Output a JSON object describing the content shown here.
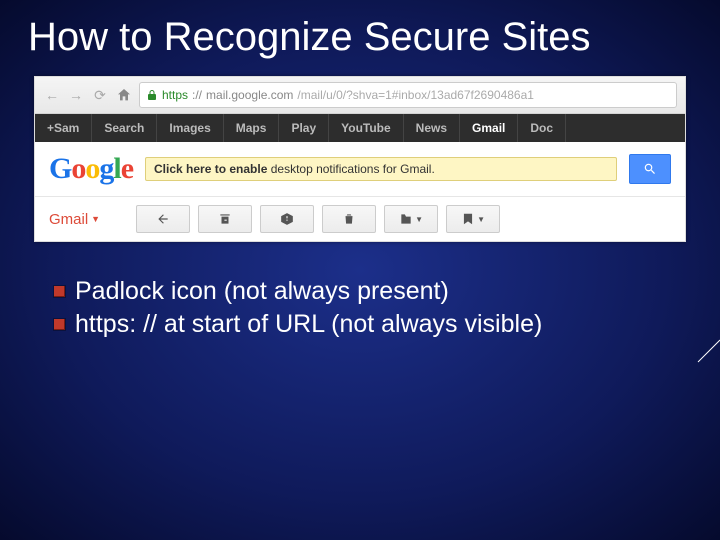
{
  "title": "How to Recognize Secure Sites",
  "browser": {
    "url": {
      "scheme": "https",
      "sep": "://",
      "host": "mail.google.com",
      "path": "/mail/u/0/?shva=1#inbox/13ad67f2690486a1"
    },
    "gbar": [
      "+Sam",
      "Search",
      "Images",
      "Maps",
      "Play",
      "YouTube",
      "News",
      "Gmail",
      "Doc"
    ],
    "gbar_active_index": 7,
    "logo_text": "Google",
    "notification": {
      "bold": "Click here to enable",
      "rest": " desktop notifications for Gmail."
    },
    "gmail_label": "Gmail"
  },
  "bullets": [
    "Padlock icon (not always present)",
    "https: // at start of URL (not always visible)"
  ]
}
